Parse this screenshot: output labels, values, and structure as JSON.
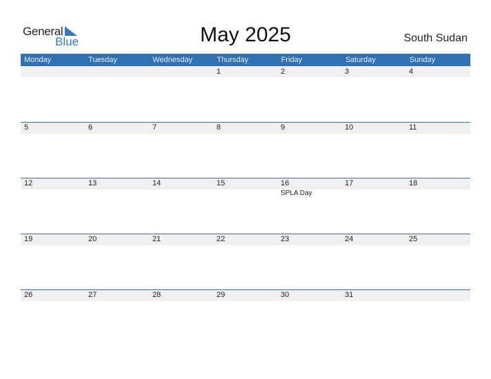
{
  "logo": {
    "general": "General",
    "blue": "Blue"
  },
  "title": "May 2025",
  "country": "South Sudan",
  "colors": {
    "accent": "#2f71b3",
    "strip": "#f0f0f0"
  },
  "weekdays": [
    "Monday",
    "Tuesday",
    "Wednesday",
    "Thursday",
    "Friday",
    "Saturday",
    "Sunday"
  ],
  "weeks": [
    [
      {
        "d": ""
      },
      {
        "d": ""
      },
      {
        "d": ""
      },
      {
        "d": "1"
      },
      {
        "d": "2"
      },
      {
        "d": "3"
      },
      {
        "d": "4"
      }
    ],
    [
      {
        "d": "5"
      },
      {
        "d": "6"
      },
      {
        "d": "7"
      },
      {
        "d": "8"
      },
      {
        "d": "9"
      },
      {
        "d": "10"
      },
      {
        "d": "11"
      }
    ],
    [
      {
        "d": "12"
      },
      {
        "d": "13"
      },
      {
        "d": "14"
      },
      {
        "d": "15"
      },
      {
        "d": "16",
        "e": "SPLA Day"
      },
      {
        "d": "17"
      },
      {
        "d": "18"
      }
    ],
    [
      {
        "d": "19"
      },
      {
        "d": "20"
      },
      {
        "d": "21"
      },
      {
        "d": "22"
      },
      {
        "d": "23"
      },
      {
        "d": "24"
      },
      {
        "d": "25"
      }
    ],
    [
      {
        "d": "26"
      },
      {
        "d": "27"
      },
      {
        "d": "28"
      },
      {
        "d": "29"
      },
      {
        "d": "30"
      },
      {
        "d": "31"
      },
      {
        "d": ""
      }
    ]
  ]
}
